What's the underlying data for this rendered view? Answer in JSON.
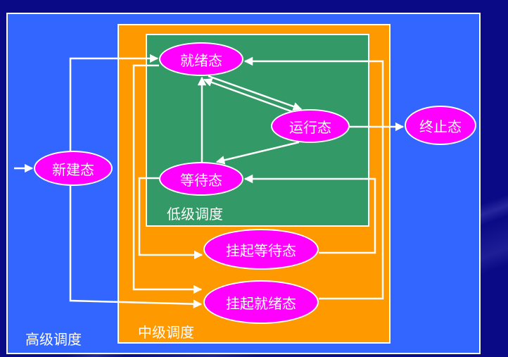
{
  "regions": {
    "high": "高级调度",
    "mid": "中级调度",
    "low": "低级调度"
  },
  "states": {
    "new": "新建态",
    "ready": "就绪态",
    "running": "运行态",
    "waiting": "等待态",
    "terminated": "终止态",
    "suspended_waiting": "挂起等待态",
    "suspended_ready": "挂起就绪态"
  },
  "colors": {
    "background": "#0a0a86",
    "high_region": "#3366ff",
    "mid_region": "#ff9900",
    "low_region": "#339966",
    "state_fill": "#ff00ff",
    "line": "#ffffff"
  }
}
